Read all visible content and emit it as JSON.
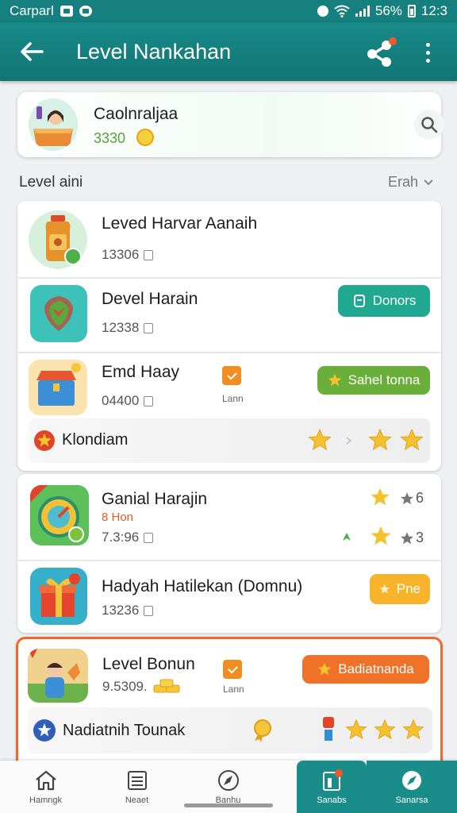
{
  "status_bar": {
    "carrier": "Carparl",
    "battery": "56%",
    "time": "12:3"
  },
  "app_bar": {
    "title": "Level Nankahan",
    "back_icon": "arrow-left-icon",
    "share_icon": "share-icon",
    "menu_icon": "more-vertical-icon"
  },
  "profile": {
    "name": "Caolnraljaa",
    "score": "3330",
    "search_icon": "search-icon"
  },
  "section": {
    "title": "Level aini",
    "filter": "Erah"
  },
  "card1": {
    "items": [
      {
        "title": "Leved Harvar Aanaih",
        "value": "13306"
      },
      {
        "title": "Devel Harain",
        "value": "12338",
        "button": "Donors"
      },
      {
        "title": "Emd Haay",
        "value": "04400",
        "badge_label": "Lann",
        "button": "Sahel tonna"
      }
    ],
    "strip": {
      "label": "Klondiam"
    }
  },
  "card2": {
    "items": [
      {
        "title": "Ganial Harajin",
        "tag": "8 Hon",
        "value": "7.3:96",
        "count_a": "6",
        "count_b": "3"
      },
      {
        "title": "Hadyah Hatilekan (Domnu)",
        "value": "13236",
        "button": "Pne"
      }
    ]
  },
  "card3": {
    "items": [
      {
        "title": "Level Bonun",
        "value": "9.5309.",
        "badge_label": "Lann",
        "button": "Badiatnanda"
      }
    ],
    "strip": {
      "label": "Nadiatnih Tounak"
    }
  },
  "bottom_nav": [
    {
      "label": "Hamngk",
      "icon": "home-icon"
    },
    {
      "label": "Neaet",
      "icon": "list-icon"
    },
    {
      "label": "Banhu",
      "icon": "compass-icon"
    },
    {
      "label": "Sanabs",
      "icon": "level-icon"
    },
    {
      "label": "Sanarsa",
      "icon": "explore-icon"
    }
  ],
  "colors": {
    "primary": "#16807f",
    "accent_orange": "#f07228",
    "accent_green": "#6aaf3a",
    "accent_teal": "#21a891",
    "accent_yellow": "#f7b42a",
    "star": "#f6c12e"
  }
}
